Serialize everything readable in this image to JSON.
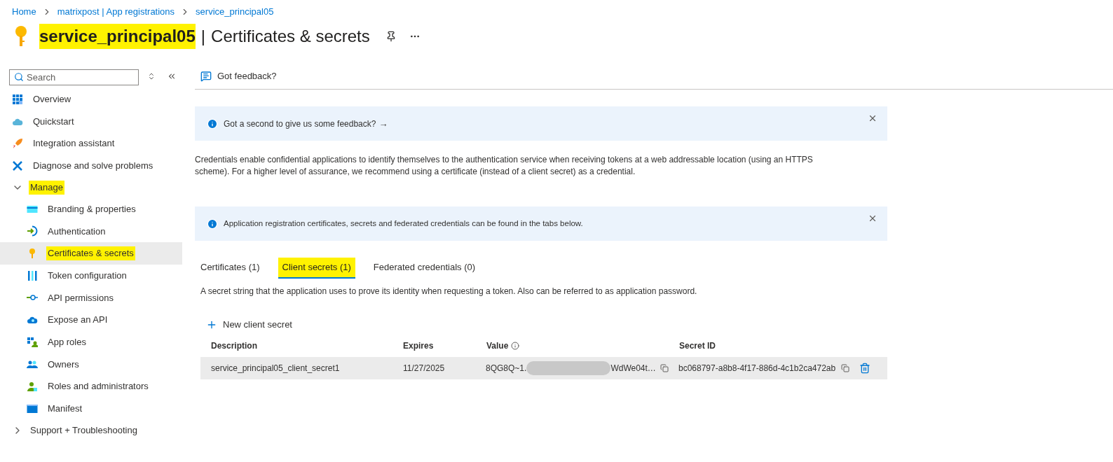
{
  "breadcrumb": [
    "Home",
    "matrixpost | App registrations",
    "service_principal05"
  ],
  "header": {
    "name": "service_principal05",
    "name_highlighted": true,
    "separator": "|",
    "page": "Certificates & secrets"
  },
  "sidebar": {
    "search": {
      "placeholder": "Search"
    },
    "items": [
      {
        "label": "Overview",
        "selected": false,
        "highlighted": false
      },
      {
        "label": "Quickstart",
        "selected": false,
        "highlighted": false
      },
      {
        "label": "Integration assistant",
        "selected": false,
        "highlighted": false
      },
      {
        "label": "Diagnose and solve problems",
        "selected": false,
        "highlighted": false
      },
      {
        "label": "Manage",
        "kind": "group",
        "expanded": true,
        "highlighted": true,
        "children": [
          {
            "label": "Branding & properties",
            "selected": false,
            "highlighted": false
          },
          {
            "label": "Authentication",
            "selected": false,
            "highlighted": false
          },
          {
            "label": "Certificates & secrets",
            "selected": true,
            "highlighted": true
          },
          {
            "label": "Token configuration",
            "selected": false,
            "highlighted": false
          },
          {
            "label": "API permissions",
            "selected": false,
            "highlighted": false
          },
          {
            "label": "Expose an API",
            "selected": false,
            "highlighted": false
          },
          {
            "label": "App roles",
            "selected": false,
            "highlighted": false
          },
          {
            "label": "Owners",
            "selected": false,
            "highlighted": false
          },
          {
            "label": "Roles and administrators",
            "selected": false,
            "highlighted": false
          },
          {
            "label": "Manifest",
            "selected": false,
            "highlighted": false
          }
        ]
      },
      {
        "label": "Support + Troubleshooting",
        "kind": "group",
        "expanded": false,
        "highlighted": false
      }
    ]
  },
  "toolbar": {
    "feedback": "Got feedback?"
  },
  "banners": [
    {
      "text": "Got a second to give us some feedback?",
      "arrow": "→"
    },
    {
      "text": "Application registration certificates, secrets and federated credentials can be found in the tabs below."
    }
  ],
  "intro": "Credentials enable confidential applications to identify themselves to the authentication service when receiving tokens at a web addressable location (using an HTTPS scheme). For a higher level of assurance, we recommend using a certificate (instead of a client secret) as a credential.",
  "tabs": [
    {
      "label": "Certificates (1)",
      "selected": false,
      "highlighted": false
    },
    {
      "label": "Client secrets (1)",
      "selected": true,
      "highlighted": true
    },
    {
      "label": "Federated credentials (0)",
      "selected": false,
      "highlighted": false
    }
  ],
  "tab_description": "A secret string that the application uses to prove its identity when requesting a token. Also can be referred to as application password.",
  "new_button": "New client secret",
  "table": {
    "columns": [
      "Description",
      "Expires",
      "Value",
      "Secret ID"
    ],
    "rows": [
      {
        "description": "service_principal05_client_secret1",
        "expires": "11/27/2025",
        "value_start": "8QG8Q~1.",
        "value_end": "WdWe04t…",
        "value_redacted": true,
        "secret_id": "bc068797-a8b8-4f17-886d-4c1b2ca472ab"
      }
    ]
  }
}
